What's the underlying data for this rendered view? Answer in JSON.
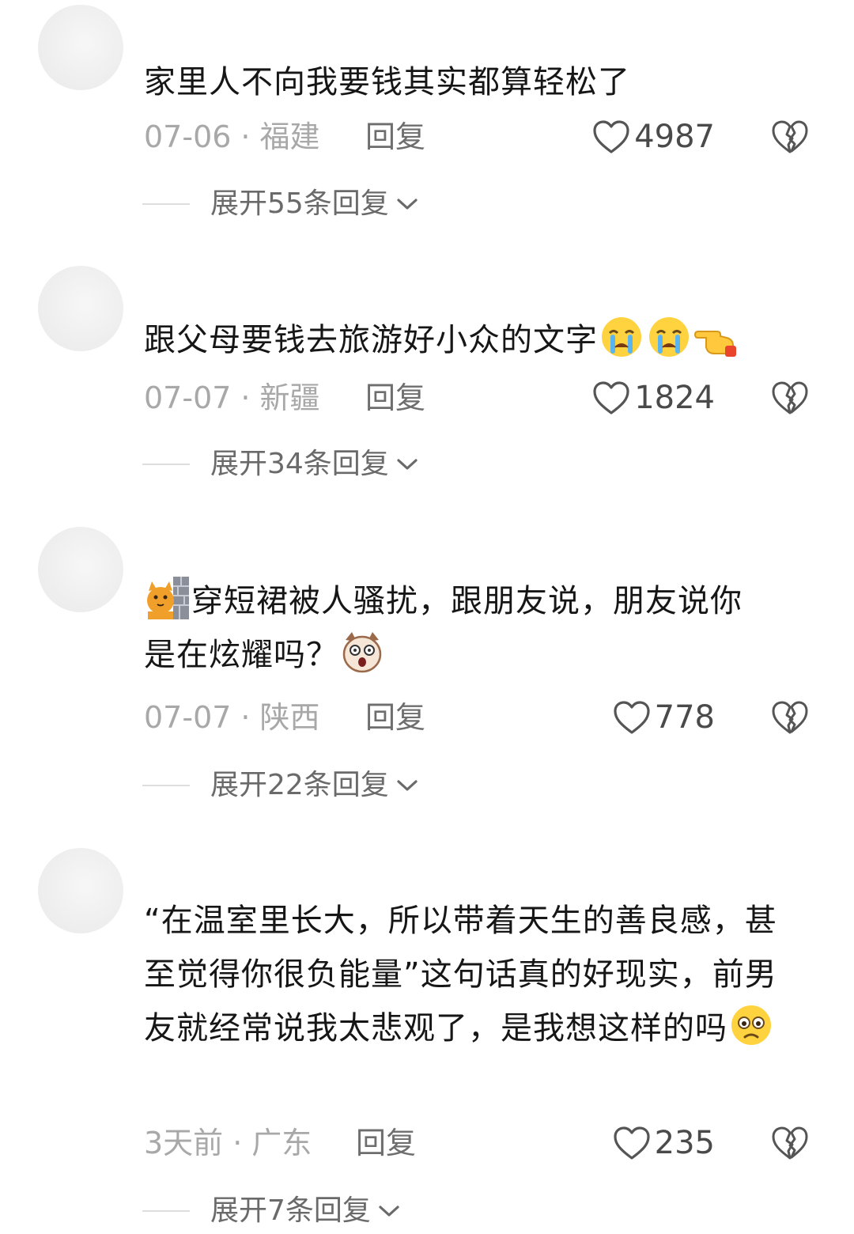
{
  "reply_label": "回复",
  "comments": [
    {
      "username": "",
      "text": "家里人不向我要钱其实都算轻松了",
      "date": "07-06",
      "location": "福建",
      "likes": "4987",
      "expand_label": "展开55条回复"
    },
    {
      "username": "",
      "text": "跟父母要钱去旅游好小众的文字",
      "emojis_after": [
        "crying-face-emoji",
        "crying-face-emoji",
        "pointing-hand-emoji"
      ],
      "date": "07-07",
      "location": "新疆",
      "likes": "1824",
      "expand_label": "展开34条回复"
    },
    {
      "username": "",
      "emoji_before": "cat-behind-wall-emoji",
      "text_line1": "穿短裙被人骚扰，跟朋友说，朋友说你",
      "text_line2": "是在炫耀吗？",
      "emoji_after": "shocked-dog-emoji",
      "date": "07-07",
      "location": "陕西",
      "likes": "778",
      "expand_label": "展开22条回复"
    },
    {
      "username": "",
      "text": "“在温室里长大，所以带着天生的善良感，甚至觉得你很负能量”这句话真的好现实，前男友就经常说我太悲观了，是我想这样的吗",
      "emoji_after": "worried-face-emoji",
      "date": "3天前",
      "location": "广东",
      "likes": "235",
      "expand_label": "展开7条回复"
    }
  ]
}
